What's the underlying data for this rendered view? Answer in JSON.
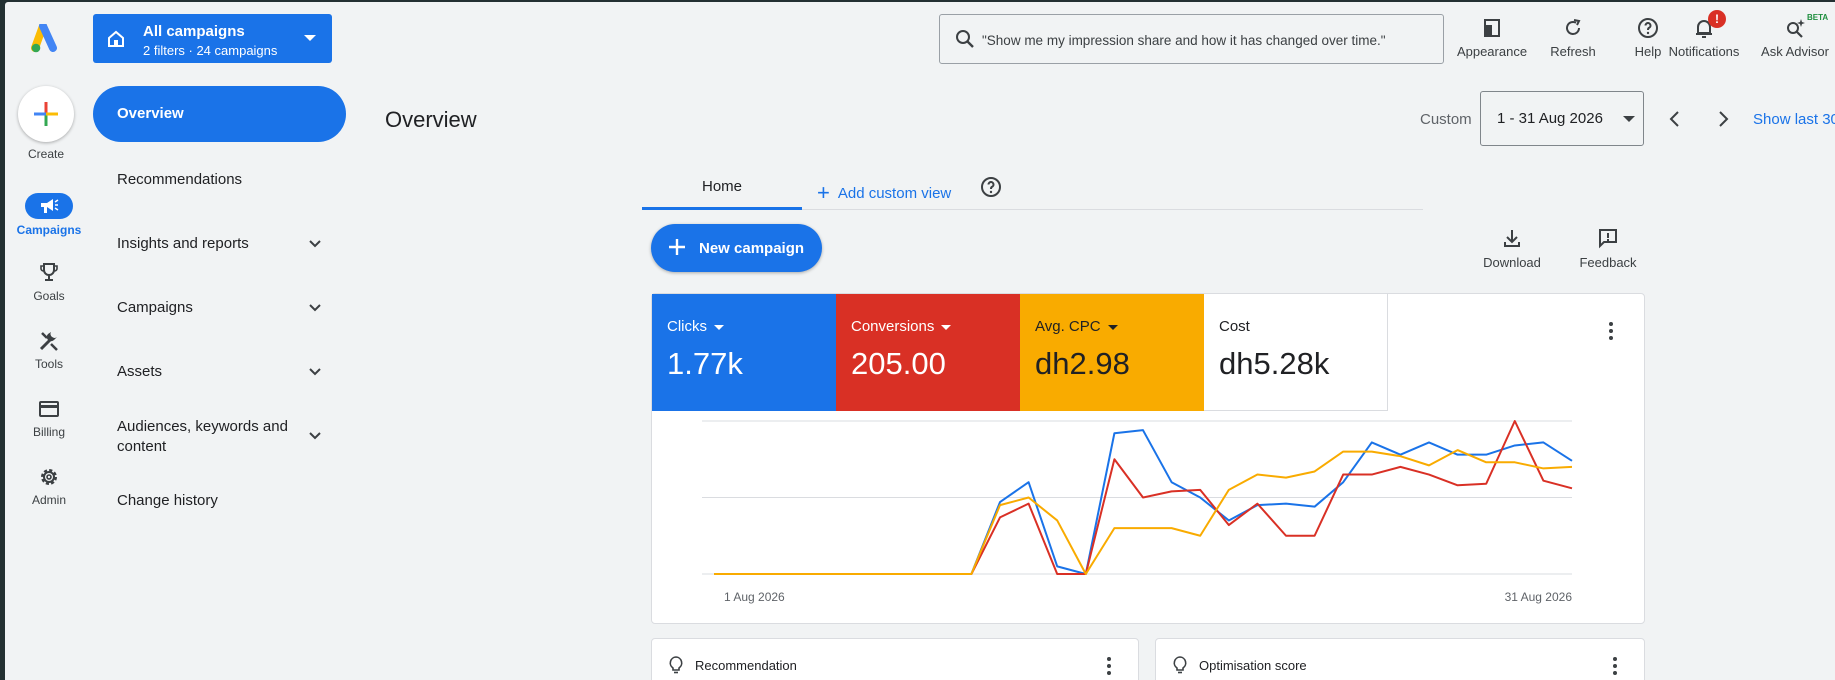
{
  "account": {
    "title": "All campaigns",
    "subtitle": "2 filters · 24 campaigns"
  },
  "search": {
    "placeholder": "\"Show me my impression share and how it has changed over time.\""
  },
  "header_tools": [
    {
      "label": "Appearance",
      "icon": "appearance-icon"
    },
    {
      "label": "Refresh",
      "icon": "refresh-icon"
    },
    {
      "label": "Help",
      "icon": "help-icon"
    },
    {
      "label": "Notifications",
      "icon": "bell-icon",
      "badge": "!"
    },
    {
      "label": "Ask Advisor",
      "icon": "advisor-icon",
      "tag": "BETA"
    }
  ],
  "rail": {
    "create_label": "Create",
    "items": [
      {
        "label": "Campaigns",
        "icon": "megaphone-icon",
        "active": true
      },
      {
        "label": "Goals",
        "icon": "trophy-icon"
      },
      {
        "label": "Tools",
        "icon": "tools-icon"
      },
      {
        "label": "Billing",
        "icon": "credit-card-icon"
      },
      {
        "label": "Admin",
        "icon": "gear-icon"
      }
    ]
  },
  "nav": {
    "active": "Overview",
    "items": [
      {
        "label": "Recommendations",
        "expandable": false
      },
      {
        "label": "Insights and reports",
        "expandable": true
      },
      {
        "label": "Campaigns",
        "expandable": true
      },
      {
        "label": "Assets",
        "expandable": true
      },
      {
        "label_line1": "Audiences, keywords and",
        "label_line2": "content",
        "expandable": true
      },
      {
        "label": "Change history",
        "expandable": false
      }
    ]
  },
  "page": {
    "title": "Overview",
    "custom_label": "Custom",
    "date_range": "1 - 31 Aug 2026",
    "show_last": "Show last 30"
  },
  "tabs": {
    "home": "Home",
    "add_custom": "Add custom view"
  },
  "actions": {
    "new_campaign": "New campaign",
    "download": "Download",
    "feedback": "Feedback"
  },
  "metrics": [
    {
      "label": "Clicks",
      "value": "1.77k",
      "bg": "#1a73e8",
      "fg": "#ffffff",
      "dropdown": true
    },
    {
      "label": "Conversions",
      "value": "205.00",
      "bg": "#d93025",
      "fg": "#ffffff",
      "dropdown": true
    },
    {
      "label": "Avg. CPC",
      "value": "dh2.98",
      "bg": "#f9ab00",
      "fg": "#202124",
      "dropdown": true
    },
    {
      "label": "Cost",
      "value": "dh5.28k",
      "bg": "#ffffff",
      "fg": "#202124",
      "dropdown": false
    }
  ],
  "chart_data": {
    "type": "line",
    "x_start_label": "1 Aug 2026",
    "x_end_label": "31 Aug 2026",
    "days": 31,
    "ylim": [
      0,
      100
    ],
    "grid": true,
    "series": [
      {
        "color": "#1a73e8",
        "values": [
          0,
          0,
          0,
          0,
          0,
          0,
          0,
          0,
          0,
          0,
          47,
          60,
          5,
          0,
          92,
          94,
          60,
          50,
          35,
          45,
          46,
          44,
          60,
          86,
          78,
          86,
          78,
          78,
          84,
          86,
          74
        ]
      },
      {
        "color": "#d93025",
        "values": [
          0,
          0,
          0,
          0,
          0,
          0,
          0,
          0,
          0,
          0,
          37,
          46,
          0,
          0,
          75,
          50,
          54,
          55,
          32,
          46,
          25,
          25,
          65,
          65,
          70,
          65,
          58,
          59,
          100,
          61,
          56
        ]
      },
      {
        "color": "#f9ab00",
        "values": [
          0,
          0,
          0,
          0,
          0,
          0,
          0,
          0,
          0,
          0,
          45,
          50,
          35,
          0,
          30,
          30,
          30,
          25,
          55,
          65,
          63,
          67,
          80,
          80,
          77,
          71,
          81,
          73,
          73,
          69,
          70
        ]
      }
    ]
  },
  "bottom_cards": [
    {
      "label": "Recommendation"
    },
    {
      "label": "Optimisation score"
    }
  ]
}
